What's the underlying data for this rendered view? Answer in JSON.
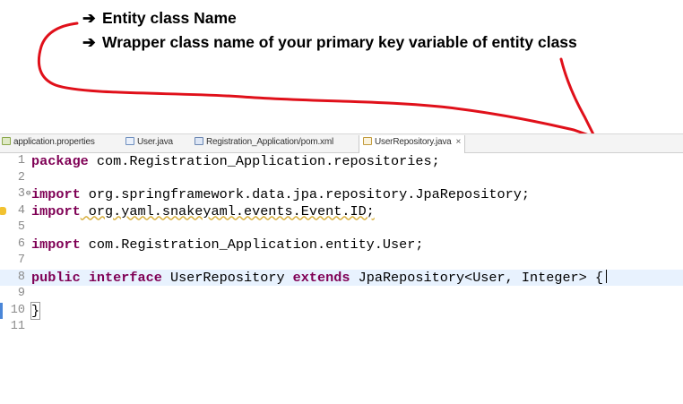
{
  "annotations": {
    "arrow_glyph": "➔",
    "line1": "Entity class Name",
    "line2": "Wrapper class name of your primary key variable of entity class",
    "stroke_color": "#e0101a"
  },
  "tabs": [
    {
      "label": "application.properties",
      "icon": "properties-file-icon",
      "active": false
    },
    {
      "label": "User.java",
      "icon": "java-file-icon",
      "active": false
    },
    {
      "label": "Registration_Application/pom.xml",
      "icon": "maven-pom-icon",
      "active": false
    },
    {
      "label": "UserRepository.java",
      "icon": "java-file-icon",
      "active": true,
      "close": "×"
    }
  ],
  "code": {
    "lines": [
      {
        "num": "1",
        "kw": "package",
        "rest": " com.Registration_Application.repositories;"
      },
      {
        "num": "2",
        "kw": "",
        "rest": ""
      },
      {
        "num": "3",
        "kw": "import",
        "rest": " org.springframework.data.jpa.repository.JpaRepository;"
      },
      {
        "num": "4",
        "kw": "import",
        "rest": " org.yaml.snakeyaml.events.Event.ID;"
      },
      {
        "num": "5",
        "kw": "",
        "rest": ""
      },
      {
        "num": "6",
        "kw": "import",
        "rest": " com.Registration_Application.entity.User;"
      },
      {
        "num": "7",
        "kw": "",
        "rest": ""
      },
      {
        "num": "8",
        "kw": "public",
        "kw2": "interface",
        "rest_a": " UserRepository ",
        "kw3": "extends",
        "rest_b": " JpaRepository<User, Integer> {"
      },
      {
        "num": "9",
        "kw": "",
        "rest": ""
      },
      {
        "num": "10",
        "kw": "",
        "rest": "}"
      },
      {
        "num": "11",
        "kw": "",
        "rest": ""
      }
    ]
  },
  "colors": {
    "keyword": "#7f0055",
    "current_line": "#e8f2fe",
    "line_number": "#8b8b8b"
  }
}
